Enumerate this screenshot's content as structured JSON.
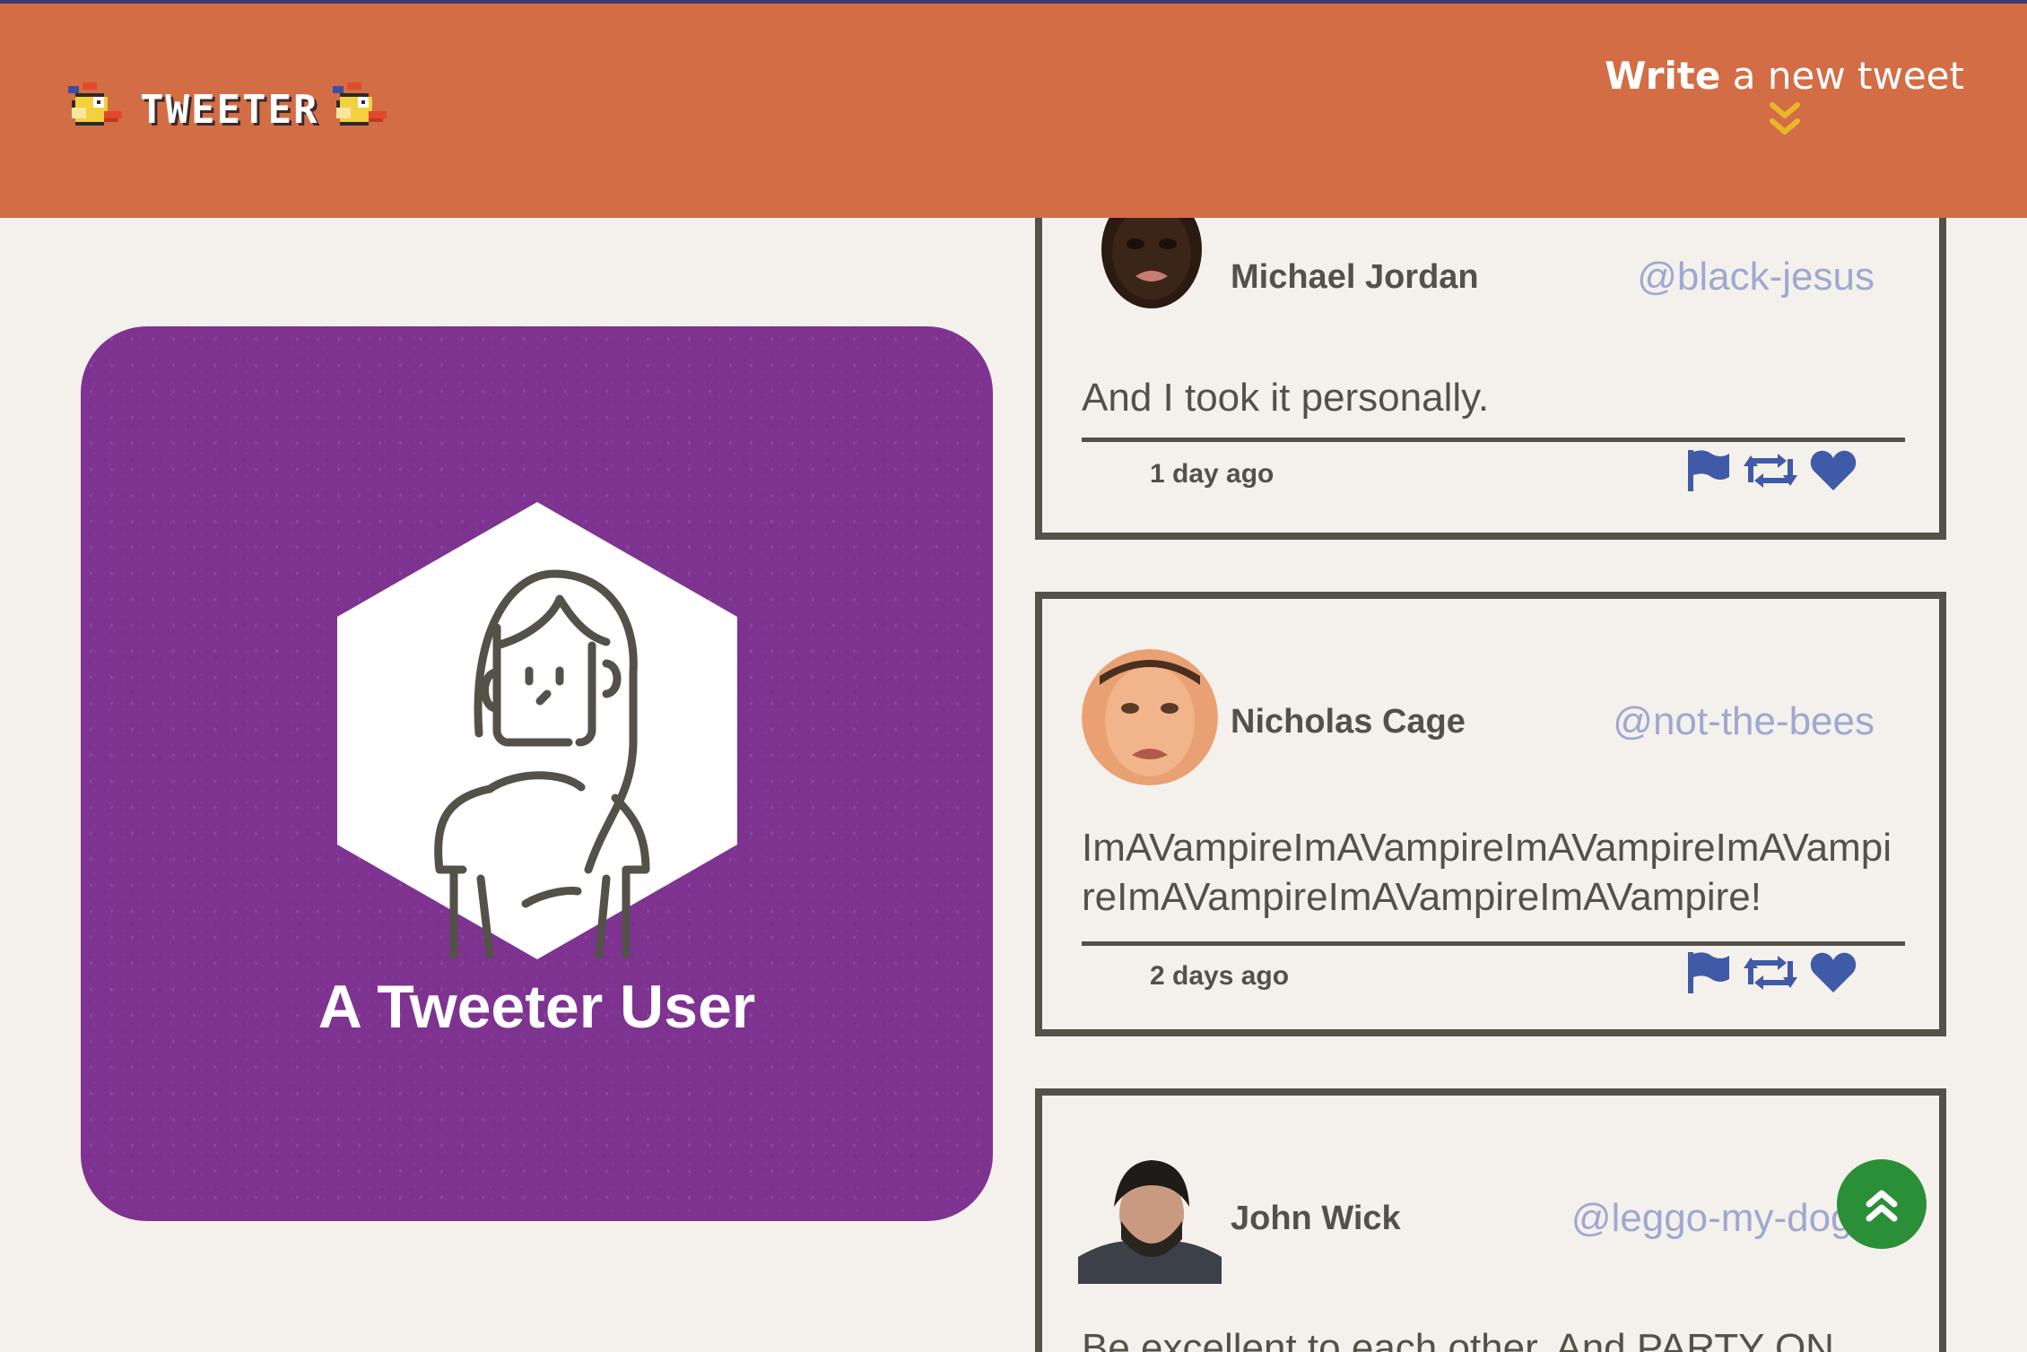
{
  "header": {
    "brand": "TWEETER",
    "compose_bold": "Write",
    "compose_rest": " a new tweet"
  },
  "profile": {
    "name": "A Tweeter User",
    "icon": "user-avatar-icon"
  },
  "tweets": [
    {
      "name": "Michael Jordan",
      "handle": "@black-jesus",
      "text": "And I took it personally.",
      "time": "1 day ago"
    },
    {
      "name": "Nicholas Cage",
      "handle": "@not-the-bees",
      "text": "ImAVampireImAVampireImAVampireImAVampireImAVampireImAVampireImAVampire!",
      "time": "2 days ago"
    },
    {
      "name": "John Wick",
      "handle": "@leggo-my-dogg",
      "text": "Be excellent to each other. And PARTY ON",
      "time": ""
    }
  ],
  "colors": {
    "header": "#d36d45",
    "profile_card": "#7e3391",
    "action_icons": "#3f5aa6",
    "handle": "#9fa8d0",
    "scroll_button": "#2b8f38",
    "compose_chevron": "#e8b828"
  }
}
